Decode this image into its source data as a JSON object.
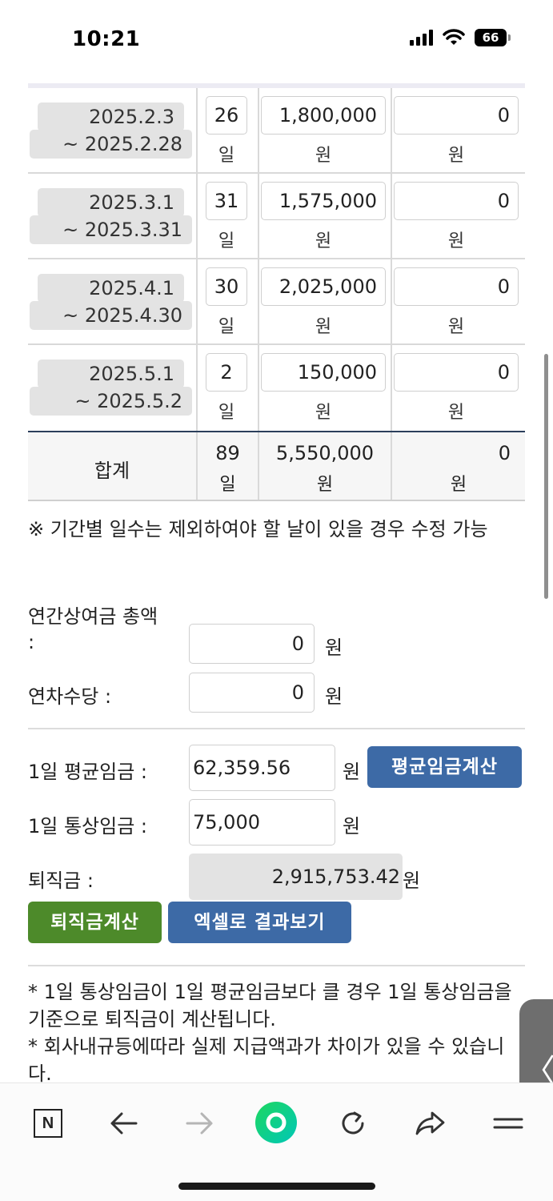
{
  "status_bar": {
    "time": "10:21",
    "battery": "66"
  },
  "table": {
    "rows": [
      {
        "date_from": "2025.2.3",
        "date_to": "~ 2025.2.28",
        "days": "26",
        "days_unit": "일",
        "wage": "1,800,000",
        "wage_unit": "원",
        "extra": "0",
        "extra_unit": "원"
      },
      {
        "date_from": "2025.3.1",
        "date_to": "~ 2025.3.31",
        "days": "31",
        "days_unit": "일",
        "wage": "1,575,000",
        "wage_unit": "원",
        "extra": "0",
        "extra_unit": "원"
      },
      {
        "date_from": "2025.4.1",
        "date_to": "~ 2025.4.30",
        "days": "30",
        "days_unit": "일",
        "wage": "2,025,000",
        "wage_unit": "원",
        "extra": "0",
        "extra_unit": "원"
      },
      {
        "date_from": "2025.5.1",
        "date_to": "~ 2025.5.2",
        "days": "2",
        "days_unit": "일",
        "wage": "150,000",
        "wage_unit": "원",
        "extra": "0",
        "extra_unit": "원"
      }
    ],
    "total": {
      "label": "합계",
      "days": "89",
      "days_unit": "일",
      "wage": "5,550,000",
      "wage_unit": "원",
      "extra": "0",
      "extra_unit": "원"
    }
  },
  "note": "※ 기간별 일수는 제외하여야 할 날이 있을 경우 수정 가능",
  "bonus": {
    "label_line1": "연간상여금 총액",
    "label_line2": ":",
    "value": "0",
    "unit": "원"
  },
  "allowance": {
    "label": "연차수당 :",
    "value": "0",
    "unit": "원"
  },
  "avg_wage": {
    "label": "1일 평균임금 :",
    "value": "62,359.56",
    "unit": "원",
    "button": "평균임금계산"
  },
  "ordinary_wage": {
    "label": "1일 통상임금 :",
    "value": "75,000",
    "unit": "원"
  },
  "severance": {
    "label": "퇴직금 :",
    "value": "2,915,753.42",
    "unit": "원"
  },
  "buttons": {
    "calculate": "퇴직금계산",
    "excel": "엑셀로 결과보기"
  },
  "footnotes": [
    "* 1일 통상임금이 1일 평균임금보다 클 경우 1일 통상임금을 기준으로 퇴직금이 계산됩니다.",
    "* 회사내규등에따라 실제 지급액과가 차이가 있을 수 있습니다."
  ],
  "side_handle": {
    "glyph": "〈"
  },
  "browser_bar": {
    "icons": [
      "naver-n-icon",
      "back-arrow-icon",
      "forward-arrow-icon",
      "green-circle-icon",
      "reload-icon",
      "share-icon",
      "menu-icon"
    ],
    "naver_letter": "N",
    "accent": "#03c75a"
  }
}
